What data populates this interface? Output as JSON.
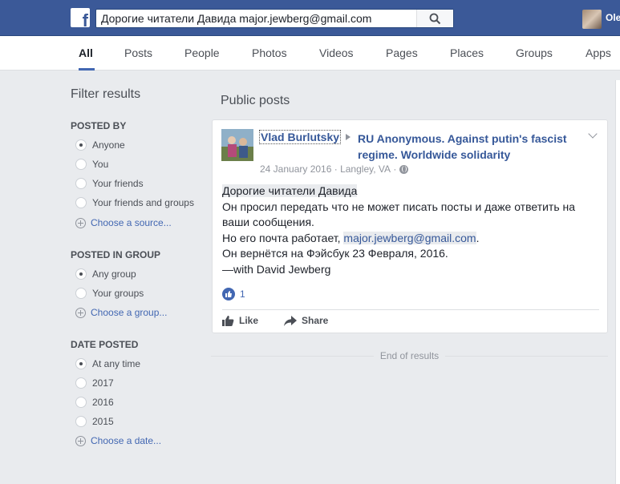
{
  "topbar": {
    "logo": "f",
    "search_value": "Дорогие читатели Давида major.jewberg@gmail.com",
    "user_name": "Ole",
    "brand_color": "#3b5998"
  },
  "tabs": [
    {
      "label": "All",
      "active": true
    },
    {
      "label": "Posts"
    },
    {
      "label": "People"
    },
    {
      "label": "Photos"
    },
    {
      "label": "Videos"
    },
    {
      "label": "Pages"
    },
    {
      "label": "Places"
    },
    {
      "label": "Groups"
    },
    {
      "label": "Apps"
    }
  ],
  "filters": {
    "title": "Filter results",
    "posted_by": {
      "heading": "POSTED BY",
      "options": [
        "Anyone",
        "You",
        "Your friends",
        "Your friends and groups"
      ],
      "selected": "Anyone",
      "choose": "Choose a source..."
    },
    "posted_in_group": {
      "heading": "POSTED IN GROUP",
      "options": [
        "Any group",
        "Your groups"
      ],
      "selected": "Any group",
      "choose": "Choose a group..."
    },
    "date_posted": {
      "heading": "DATE POSTED",
      "options": [
        "At any time",
        "2017",
        "2016",
        "2015"
      ],
      "selected": "At any time",
      "choose": "Choose a date..."
    }
  },
  "results": {
    "section_title": "Public posts",
    "post": {
      "author": "Vlad Burlutsky",
      "group": "RU Anonymous. Against putin's fascist regime. Worldwide solidarity",
      "date": "24 January 2016",
      "location": "Langley, VA",
      "lines": {
        "l1": "Дорогие читатели Давида",
        "l2": "Он просил передать что не может писать посты и даже ответить на ваши сообщения.",
        "l3_prefix": "Но его почта работает, ",
        "l3_email": "major.jewberg@gmail.com",
        "l3_suffix": ".",
        "l4": "Он вернётся на Фэйсбук 23 Февраля, 2016.",
        "l5": "—with David Jewberg"
      },
      "reaction_count": "1",
      "like_label": "Like",
      "share_label": "Share"
    },
    "end_text": "End of results"
  }
}
